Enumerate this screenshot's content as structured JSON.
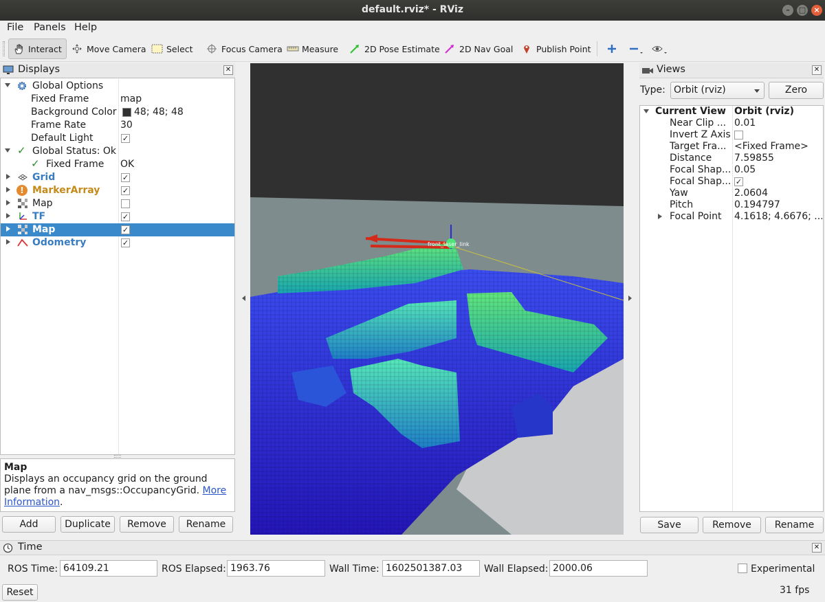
{
  "window": {
    "title": "default.rviz* - RViz"
  },
  "menu": {
    "file": "File",
    "panels": "Panels",
    "help": "Help"
  },
  "toolbar": {
    "interact": "Interact",
    "move_camera": "Move Camera",
    "select": "Select",
    "focus_camera": "Focus Camera",
    "measure": "Measure",
    "pose_estimate": "2D Pose Estimate",
    "nav_goal": "2D Nav Goal",
    "publish_point": "Publish Point"
  },
  "displays": {
    "title": "Displays",
    "global_options": "Global Options",
    "fixed_frame_label": "Fixed Frame",
    "fixed_frame_value": "map",
    "background_color_label": "Background Color",
    "background_color_value": "48; 48; 48",
    "background_color_hex": "#303030",
    "frame_rate_label": "Frame Rate",
    "frame_rate_value": "30",
    "default_light_label": "Default Light",
    "global_status": "Global Status: Ok",
    "status_fixed_frame_label": "Fixed Frame",
    "status_fixed_frame_value": "OK",
    "items": [
      {
        "label": "Grid",
        "checked": true
      },
      {
        "label": "MarkerArray",
        "checked": true
      },
      {
        "label": "Map",
        "checked": false
      },
      {
        "label": "TF",
        "checked": true
      },
      {
        "label": "Map",
        "checked": true
      },
      {
        "label": "Odometry",
        "checked": true
      }
    ],
    "description_title": "Map",
    "description_text": "Displays an occupancy grid on the ground plane from a nav_msgs::OccupancyGrid.",
    "description_link_1": "More",
    "description_link_2": "Information",
    "description_period": ".",
    "buttons": {
      "add": "Add",
      "duplicate": "Duplicate",
      "remove": "Remove",
      "rename": "Rename"
    }
  },
  "views": {
    "title": "Views",
    "type_label": "Type:",
    "type_value": "Orbit (rviz)",
    "zero_button": "Zero",
    "current_view_label": "Current View",
    "current_view_value": "Orbit (rviz)",
    "properties": [
      {
        "label": "Near Clip ...",
        "value": "0.01"
      },
      {
        "label": "Invert Z Axis",
        "value": ""
      },
      {
        "label": "Target Fra...",
        "value": "<Fixed Frame>"
      },
      {
        "label": "Distance",
        "value": "7.59855"
      },
      {
        "label": "Focal Shap...",
        "value": "0.05"
      },
      {
        "label": "Focal Shap...",
        "value": ""
      },
      {
        "label": "Yaw",
        "value": "2.0604"
      },
      {
        "label": "Pitch",
        "value": "0.194797"
      },
      {
        "label": "Focal Point",
        "value": "4.1618; 4.6676; ..."
      }
    ],
    "buttons": {
      "save": "Save",
      "remove": "Remove",
      "rename": "Rename"
    }
  },
  "time": {
    "title": "Time",
    "ros_time_label": "ROS Time:",
    "ros_time_value": "64109.21",
    "ros_elapsed_label": "ROS Elapsed:",
    "ros_elapsed_value": "1963.76",
    "wall_time_label": "Wall Time:",
    "wall_time_value": "1602501387.03",
    "wall_elapsed_label": "Wall Elapsed:",
    "wall_elapsed_value": "2000.06",
    "experimental_label": "Experimental",
    "reset_button": "Reset",
    "fps": "31 fps"
  },
  "scene": {
    "tf_label": "front_laser_link"
  },
  "colors": {
    "accent": "#3a8acb",
    "link": "#2a55c8",
    "close_button": "#e2603a"
  }
}
